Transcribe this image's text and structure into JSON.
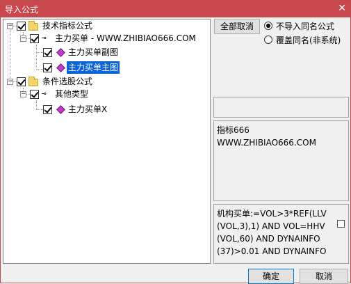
{
  "window": {
    "title": "导入公式",
    "close_glyph": "✕"
  },
  "tree": {
    "nodes": [
      {
        "label": "技术指标公式"
      },
      {
        "label": "主力买单 - WWW.ZHIBIAO666.COM"
      },
      {
        "label": "主力买单副图"
      },
      {
        "label": "主力买单主图"
      },
      {
        "label": "条件选股公式"
      },
      {
        "label": "其他类型"
      },
      {
        "label": "主力买单X"
      }
    ]
  },
  "options": {
    "select_all_button": "全部取消",
    "radio_skip_label": "不导入同名公式",
    "radio_overwrite_label": "覆盖同名(非系统)"
  },
  "info": {
    "line1": "指标666",
    "line2": "WWW.ZHIBIAO666.COM"
  },
  "formula": {
    "text": "机构买单:=VOL>3*REF(LLV\n(VOL,3),1) AND VOL=HHV\n(VOL,60) AND DYNAINFO\n(37)>0.01 AND DYNAINFO"
  },
  "footer": {
    "ok": "确定",
    "cancel": "取消"
  }
}
